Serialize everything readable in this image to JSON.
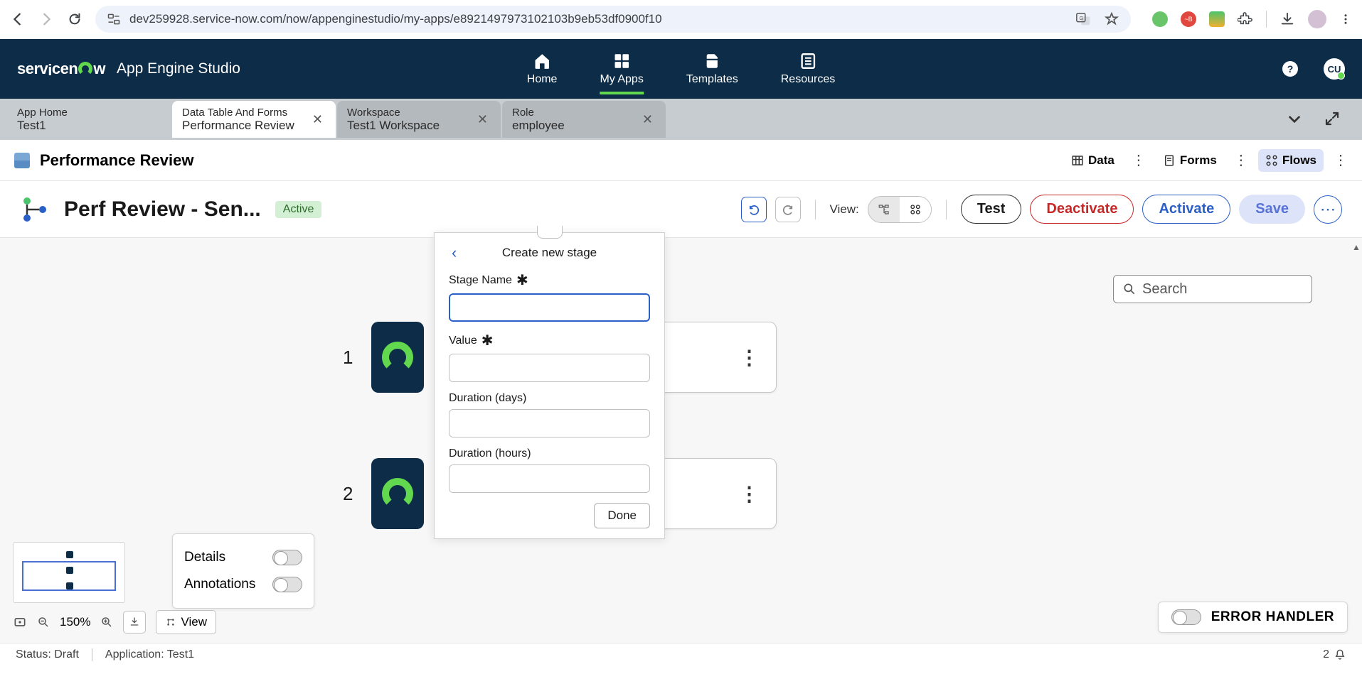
{
  "browser": {
    "url": "dev259928.service-now.com/now/appenginestudio/my-apps/e8921497973102103b9eb53df0900f10"
  },
  "header": {
    "app_name": "App Engine Studio",
    "nav": {
      "home": "Home",
      "myapps": "My Apps",
      "templates": "Templates",
      "resources": "Resources"
    },
    "user_initials": "CU"
  },
  "tabs": [
    {
      "type": "App Home",
      "title": "Test1",
      "closeable": false
    },
    {
      "type": "Data Table And Forms",
      "title": "Performance Review",
      "closeable": true
    },
    {
      "type": "Workspace",
      "title": "Test1 Workspace",
      "closeable": true
    },
    {
      "type": "Role",
      "title": "employee",
      "closeable": true
    }
  ],
  "subheader": {
    "title": "Performance Review",
    "data": "Data",
    "forms": "Forms",
    "flows": "Flows"
  },
  "actionbar": {
    "flow_title": "Perf Review - Sen...",
    "status": "Active",
    "view_label": "View:",
    "test": "Test",
    "deactivate": "Deactivate",
    "activate": "Activate",
    "save": "Save"
  },
  "canvas": {
    "steps": [
      {
        "num": "1"
      },
      {
        "num": "2"
      }
    ],
    "search_placeholder": "Search"
  },
  "popover": {
    "title": "Create new stage",
    "fields": {
      "stage_name": "Stage Name",
      "value": "Value",
      "duration_days": "Duration (days)",
      "duration_hours": "Duration (hours)"
    },
    "done": "Done"
  },
  "toggle_panel": {
    "details": "Details",
    "annotations": "Annotations"
  },
  "zoom": {
    "pct": "150%",
    "view": "View"
  },
  "error_handler": {
    "label": "ERROR HANDLER"
  },
  "footer": {
    "status": "Status: Draft",
    "application": "Application: Test1",
    "count": "2"
  }
}
